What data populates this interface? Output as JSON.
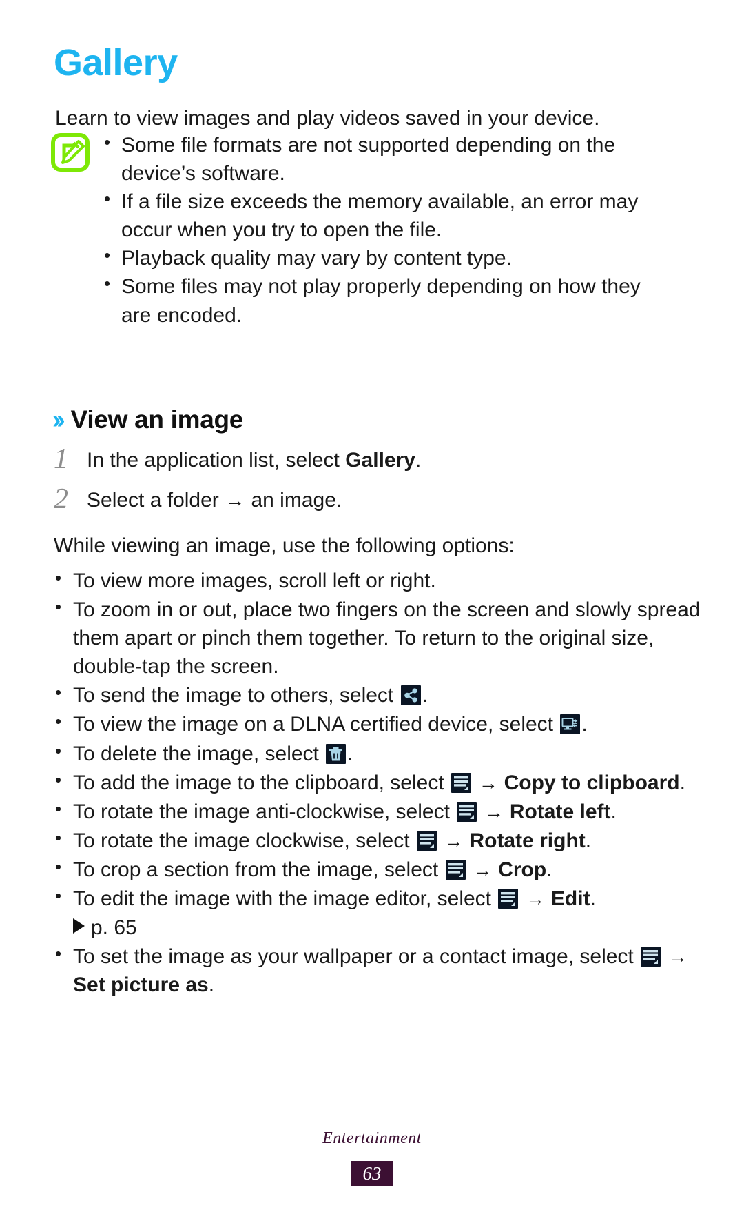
{
  "page": {
    "chapter_title": "Gallery",
    "intro": "Learn to view images and play videos saved in your device.",
    "accent_color": "#1eb4f0",
    "note_icon_color": "#7ee806",
    "footer_color": "#3c1033"
  },
  "note": {
    "icon": "note-pencil-icon",
    "items": [
      "Some file formats are not supported depending on the device’s software.",
      "If a file size exceeds the memory available, an error may occur when you try to open the file.",
      "Playback quality may vary by content type.",
      "Some files may not play properly depending on how they are encoded."
    ]
  },
  "section": {
    "chevron": "››",
    "heading": "View an image"
  },
  "steps": [
    {
      "number": "1",
      "text_before": "In the application list, select ",
      "bold": "Gallery",
      "text_after": "."
    },
    {
      "number": "2",
      "text_before": "Select a folder ",
      "arrow": "→",
      "text_after": " an image."
    }
  ],
  "options_intro": "While viewing an image, use the following options:",
  "options": [
    {
      "id": "scroll",
      "before": "To view more images, scroll left or right.",
      "icon": null,
      "arrow": null,
      "bold": null,
      "after": null
    },
    {
      "id": "zoom",
      "before": "To zoom in or out, place two fingers on the screen and slowly spread them apart or pinch them together. To return to the original size, double-tap the screen.",
      "icon": null,
      "arrow": null,
      "bold": null,
      "after": null
    },
    {
      "id": "share",
      "before": "To send the image to others, select ",
      "icon": "share-icon",
      "arrow": null,
      "bold": null,
      "after": "."
    },
    {
      "id": "dlna",
      "before": "To view the image on a DLNA certified device, select ",
      "icon": "dlna-screen-icon",
      "arrow": null,
      "bold": null,
      "after": "."
    },
    {
      "id": "delete",
      "before": "To delete the image, select ",
      "icon": "trash-icon",
      "arrow": null,
      "bold": null,
      "after": "."
    },
    {
      "id": "clipboard",
      "before": "To add the image to the clipboard, select ",
      "icon": "menu-icon",
      "arrow": "→",
      "bold": "Copy to clipboard",
      "after": "."
    },
    {
      "id": "rotate-left",
      "before": "To rotate the image anti-clockwise, select ",
      "icon": "menu-icon",
      "arrow": "→",
      "bold": "Rotate left",
      "after": "."
    },
    {
      "id": "rotate-right",
      "before": "To rotate the image clockwise, select ",
      "icon": "menu-icon",
      "arrow": "→",
      "bold": "Rotate right",
      "after": "."
    },
    {
      "id": "crop",
      "before": "To crop a section from the image, select ",
      "icon": "menu-icon",
      "arrow": "→",
      "bold": "Crop",
      "after": "."
    },
    {
      "id": "edit",
      "before": "To edit the image with the image editor, select ",
      "icon": "menu-icon",
      "arrow": "→",
      "bold": "Edit",
      "after": "."
    },
    {
      "id": "set-picture-as",
      "before": "To set the image as your wallpaper or a contact image, select ",
      "icon": "menu-icon",
      "arrow": "→",
      "bold": "Set picture as",
      "after": "."
    }
  ],
  "cross_reference": {
    "marker": "play-triangle-icon",
    "text": "p. 65"
  },
  "footer": {
    "label": "Entertainment",
    "page_number": "63"
  }
}
